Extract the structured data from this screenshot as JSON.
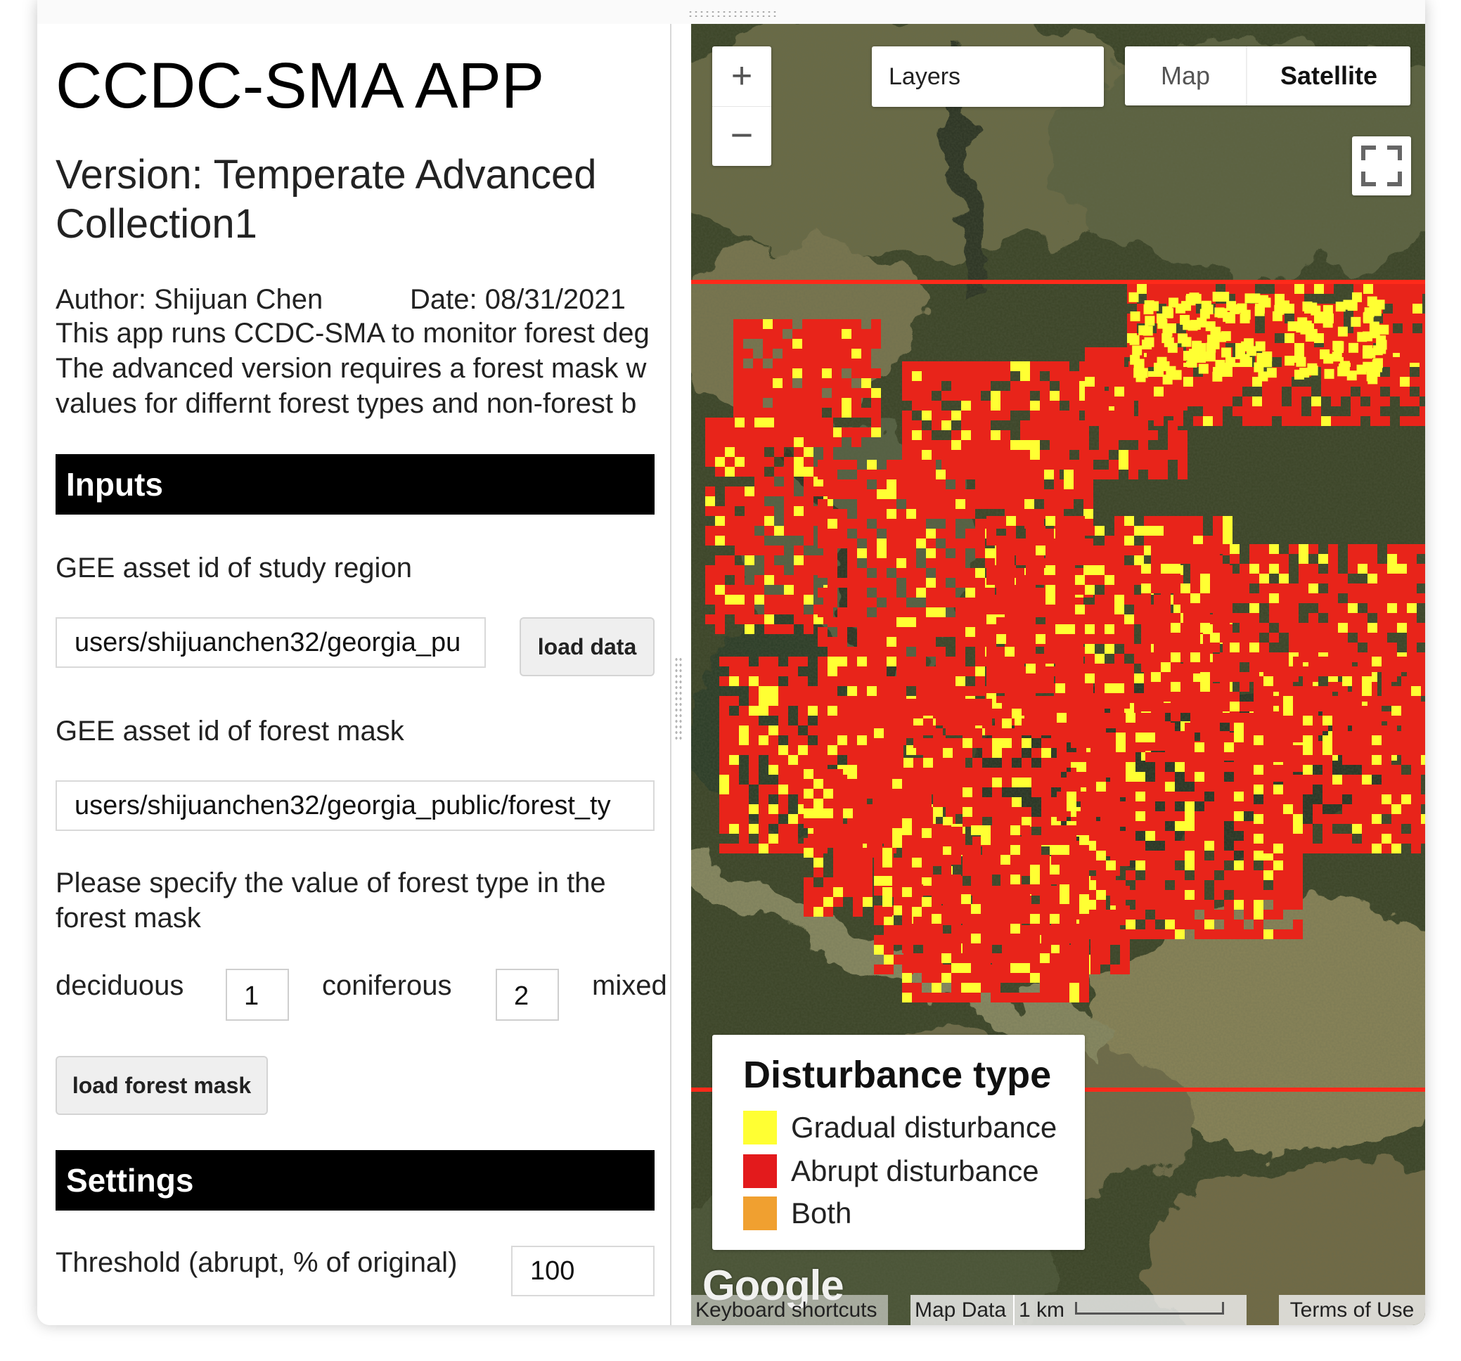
{
  "panel": {
    "title": "CCDC-SMA APP",
    "version": "Version: Temperate Advanced Collection1",
    "author": "Author: Shijuan Chen",
    "date": "Date: 08/31/2021",
    "description_lines": [
      "This app runs CCDC-SMA to monitor forest deg",
      "The advanced version requires a forest mask w",
      "values for differnt forest types and non-forest b"
    ],
    "inputs_header": "Inputs",
    "study_region_label": "GEE asset id of study region",
    "study_region_value": "users/shijuanchen32/georgia_pu",
    "load_data_button": "load data",
    "forest_mask_label": "GEE asset id of forest mask",
    "forest_mask_value": "users/shijuanchen32/georgia_public/forest_ty",
    "forest_type_prompt_lines": [
      "Please specify the value of forest type in the",
      "forest mask"
    ],
    "deciduous_label": "deciduous",
    "deciduous_value": "1",
    "coniferous_label": "coniferous",
    "coniferous_value": "2",
    "mixed_label": "mixed",
    "load_forest_mask_button": "load forest mask",
    "settings_header": "Settings",
    "threshold_label": "Threshold (abrupt, % of original)",
    "threshold_value": "100"
  },
  "map": {
    "zoom_in": "+",
    "zoom_out": "−",
    "layers_label": "Layers",
    "map_type_map": "Map",
    "map_type_satellite": "Satellite",
    "selected_map_type": "Satellite",
    "fullscreen_icon": "fullscreen-icon",
    "legend": {
      "title": "Disturbance type",
      "items": [
        {
          "label": "Gradual disturbance",
          "color": "#ffff33"
        },
        {
          "label": "Abrupt disturbance",
          "color": "#e31a1c"
        },
        {
          "label": "Both",
          "color": "#f0a030"
        }
      ]
    },
    "attribution": {
      "logo": "Google",
      "keyboard_shortcuts": "Keyboard shortcuts",
      "map_data": "Map Data",
      "scale_label": "1 km",
      "terms": "Terms of Use"
    },
    "colors": {
      "abrupt": "#e8241a",
      "gradual": "#ffff33",
      "boundary_line": "#ff2a1a"
    }
  }
}
